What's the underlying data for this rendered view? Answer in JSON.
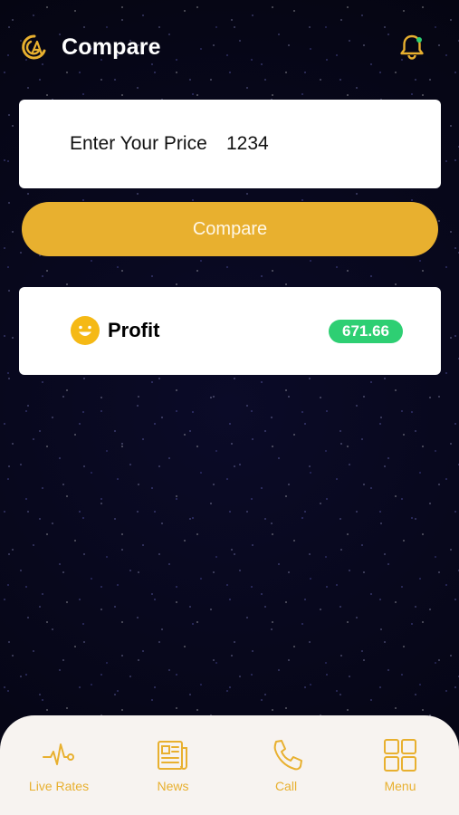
{
  "header": {
    "title": "Compare",
    "logo_icon": "gold-coin-logo-icon",
    "notification_icon": "bell-icon"
  },
  "price_form": {
    "label": "Enter Your Price",
    "value": "1234"
  },
  "compare_button": {
    "label": "Compare"
  },
  "result": {
    "icon": "smiley-icon",
    "label": "Profit",
    "value": "671.66",
    "status_color": "#2ecf73"
  },
  "tabbar": {
    "items": [
      {
        "label": "Live Rates",
        "icon": "pulse-line-icon"
      },
      {
        "label": "News",
        "icon": "newspaper-icon"
      },
      {
        "label": "Call",
        "icon": "phone-icon"
      },
      {
        "label": "Menu",
        "icon": "grid-icon"
      }
    ]
  },
  "colors": {
    "accent": "#e8b02f",
    "card": "#ffffff",
    "tabbar_bg": "#f7f3f0",
    "background": "#07071a"
  }
}
